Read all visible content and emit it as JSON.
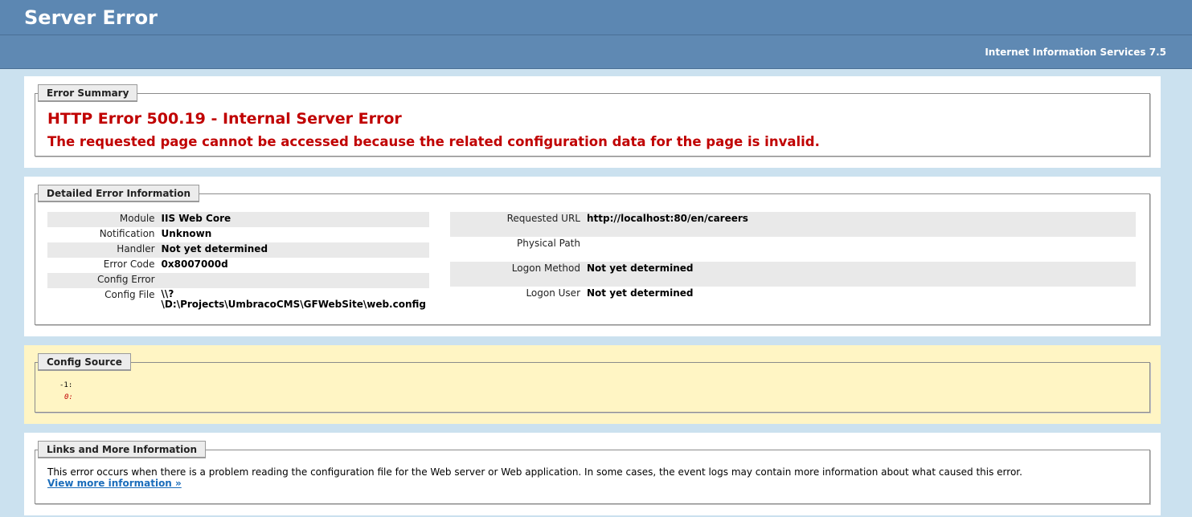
{
  "header": {
    "title": "Server Error"
  },
  "server": {
    "name": "Internet Information Services 7.5"
  },
  "summary": {
    "legend": "Error Summary",
    "title": "HTTP Error 500.19 - Internal Server Error",
    "message": "The requested page cannot be accessed because the related configuration data for the page is invalid."
  },
  "detailed": {
    "legend": "Detailed Error Information",
    "left": [
      {
        "key": "Module",
        "value": "IIS Web Core"
      },
      {
        "key": "Notification",
        "value": "Unknown"
      },
      {
        "key": "Handler",
        "value": "Not yet determined"
      },
      {
        "key": "Error Code",
        "value": "0x8007000d"
      },
      {
        "key": "Config Error",
        "value": ""
      },
      {
        "key": "Config File",
        "value_line1": "\\\\?",
        "value_line2": "\\D:\\Projects\\UmbracoCMS\\GFWebSite\\web.config"
      }
    ],
    "right": [
      {
        "key": "Requested URL",
        "value": "http://localhost:80/en/careers"
      },
      {
        "key": "Physical Path",
        "value": ""
      },
      {
        "key": "Logon Method",
        "value": "Not yet determined"
      },
      {
        "key": "Logon User",
        "value": "Not yet determined"
      }
    ]
  },
  "config_source": {
    "legend": "Config Source",
    "line1": "-1:",
    "line2": "0:"
  },
  "links": {
    "legend": "Links and More Information",
    "text": "This error occurs when there is a problem reading the configuration file for the Web server or Web application. In some cases, the event logs may contain more information about what caused this error.",
    "link_label": "View more information »"
  },
  "colors": {
    "header_bg": "#5c87b2",
    "page_bg": "#cbe1ef",
    "error_red": "#c00000",
    "config_bg": "#fff5c4",
    "link": "#1b6dbb"
  }
}
